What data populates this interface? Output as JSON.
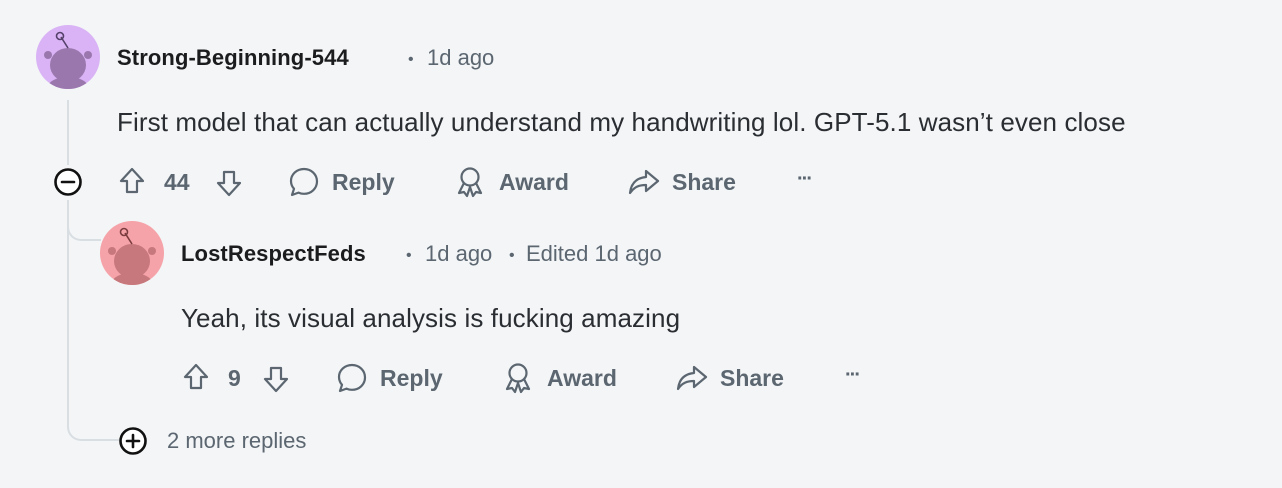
{
  "comment": {
    "username": "Strong-Beginning-544",
    "timestamp": "1d ago",
    "body": "First model that can actually understand my handwriting lol. GPT-5.1 wasn’t even close",
    "score": "44",
    "actions": {
      "reply": "Reply",
      "award": "Award",
      "share": "Share",
      "more": "···"
    },
    "avatar_color": "#d9b3f5"
  },
  "reply": {
    "username": "LostRespectFeds",
    "timestamp": "1d ago",
    "edited": "Edited 1d ago",
    "body": "Yeah, its visual analysis is fucking amazing",
    "score": "9",
    "actions": {
      "reply": "Reply",
      "award": "Award",
      "share": "Share",
      "more": "···"
    },
    "avatar_color": "#f5a3a8"
  },
  "more_replies": "2 more replies",
  "separator": "•"
}
